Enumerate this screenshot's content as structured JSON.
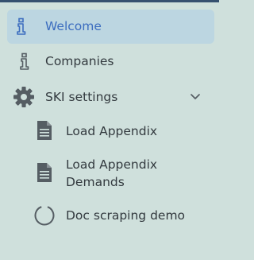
{
  "sidebar": {
    "items": [
      {
        "label": "Welcome",
        "icon": "info-icon",
        "active": true
      },
      {
        "label": "Companies",
        "icon": "info-icon"
      },
      {
        "label": "SKI settings",
        "icon": "gear-icon",
        "expanded": true,
        "toggle_icon": "chevron-down-icon",
        "children": [
          {
            "label": "Load Appendix",
            "icon": "document-icon"
          },
          {
            "label": "Load Appendix Demands",
            "icon": "document-icon"
          },
          {
            "label": "Doc scraping demo",
            "icon": "loading-circle-icon"
          }
        ]
      }
    ]
  },
  "colors": {
    "background": "#cfe0dc",
    "active_background": "#bcd6e1",
    "active_text": "#3c6dbf",
    "text": "#333a3f",
    "icon": "#555d63",
    "top_bar": "#35506f"
  }
}
